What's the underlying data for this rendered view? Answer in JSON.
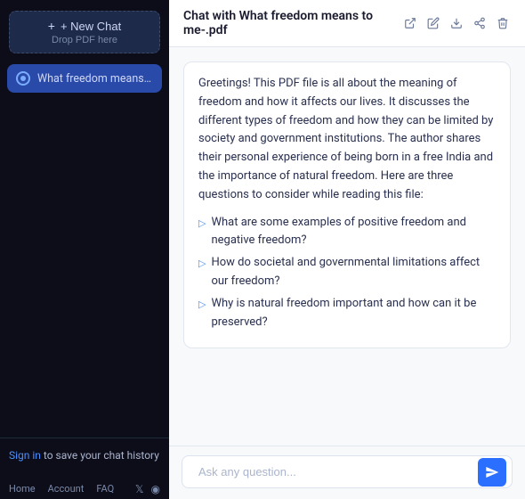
{
  "sidebar": {
    "new_chat_label": "+ New Chat",
    "drop_pdf_label": "Drop PDF here",
    "chat_items": [
      {
        "label": "What freedom means to me-..."
      }
    ],
    "signin_prefix": "Sign in",
    "signin_suffix": " to save your chat history",
    "nav": {
      "home": "Home",
      "account": "Account",
      "faq": "FAQ"
    }
  },
  "header": {
    "title": "Chat with What freedom means to me-.pdf"
  },
  "message": {
    "intro": "Greetings! This PDF file is all about the meaning of freedom and how it affects our lives. It discusses the different types of freedom and how they can be limited by society and government institutions. The author shares their personal experience of being born in a free India and the importance of natural freedom. Here are three questions to consider while reading this file:",
    "questions": [
      "What are some examples of positive freedom and negative freedom?",
      "How do societal and governmental limitations affect our freedom?",
      "Why is natural freedom important and how can it be preserved?"
    ]
  },
  "input": {
    "placeholder": "Ask any question..."
  },
  "icons": {
    "plus": "+",
    "external_link": "↗",
    "edit": "✎",
    "download": "↓",
    "share": "⤴",
    "trash": "🗑",
    "send": "➤",
    "arrow": "▷",
    "twitter": "𝕏",
    "discord": "◉"
  }
}
